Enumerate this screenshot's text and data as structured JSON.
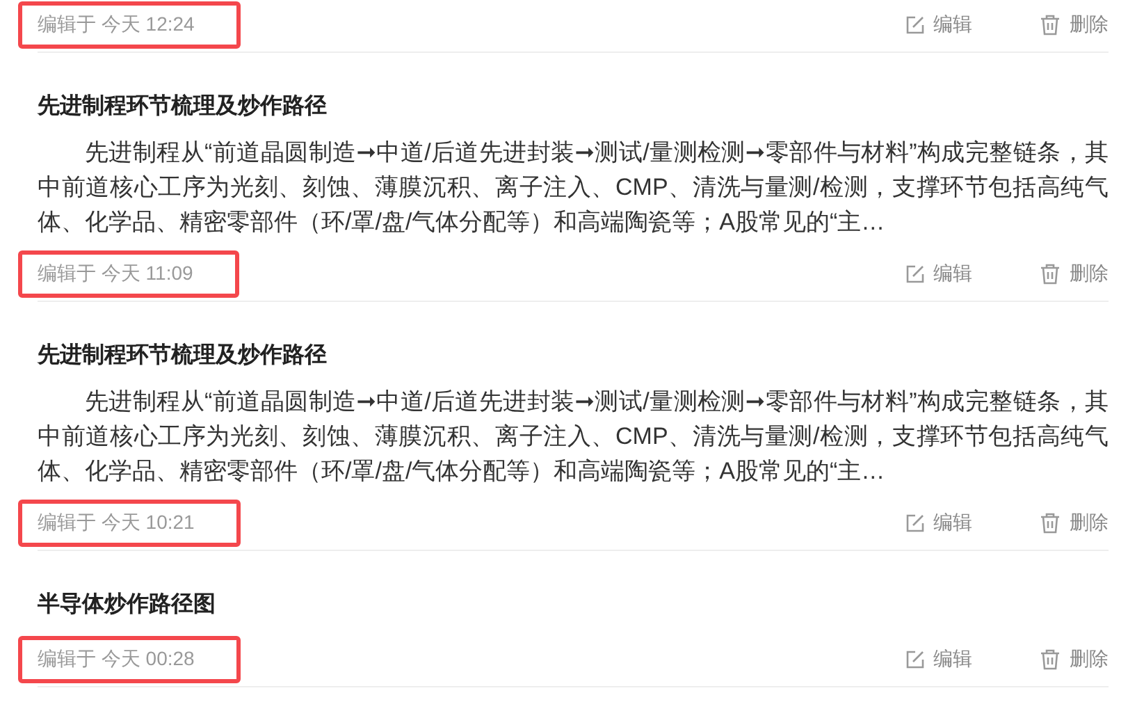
{
  "notes": [
    {
      "edited": "编辑于 今天 12:24",
      "highlighted": true,
      "actions": [
        "编辑",
        "删除"
      ]
    },
    {
      "title": "先进制程环节梳理及炒作路径",
      "body": "先进制程从“前道晶圆制造➞中道/后道先进封装➞测试/量测检测➞零部件与材料”构成完整链条，其中前道核心工序为光刻、刻蚀、薄膜沉积、离子注入、CMP、清洗与量测/检测，支撑环节包括高纯气体、化学品、精密零部件（环/罩/盘/气体分配等）和高端陶瓷等；A股常见的“主…",
      "edited": "编辑于 今天 11:09",
      "highlighted": true,
      "actions": [
        "编辑",
        "删除"
      ]
    },
    {
      "title": "先进制程环节梳理及炒作路径",
      "body": "先进制程从“前道晶圆制造➞中道/后道先进封装➞测试/量测检测➞零部件与材料”构成完整链条，其中前道核心工序为光刻、刻蚀、薄膜沉积、离子注入、CMP、清洗与量测/检测，支撑环节包括高纯气体、化学品、精密零部件（环/罩/盘/气体分配等）和高端陶瓷等；A股常见的“主…",
      "edited": "编辑于 今天 10:21",
      "highlighted": true,
      "actions": [
        "编辑",
        "删除"
      ]
    },
    {
      "title": "半导体炒作路径图",
      "edited": "编辑于 今天 00:28",
      "highlighted": true,
      "actions": [
        "编辑",
        "删除"
      ]
    }
  ]
}
